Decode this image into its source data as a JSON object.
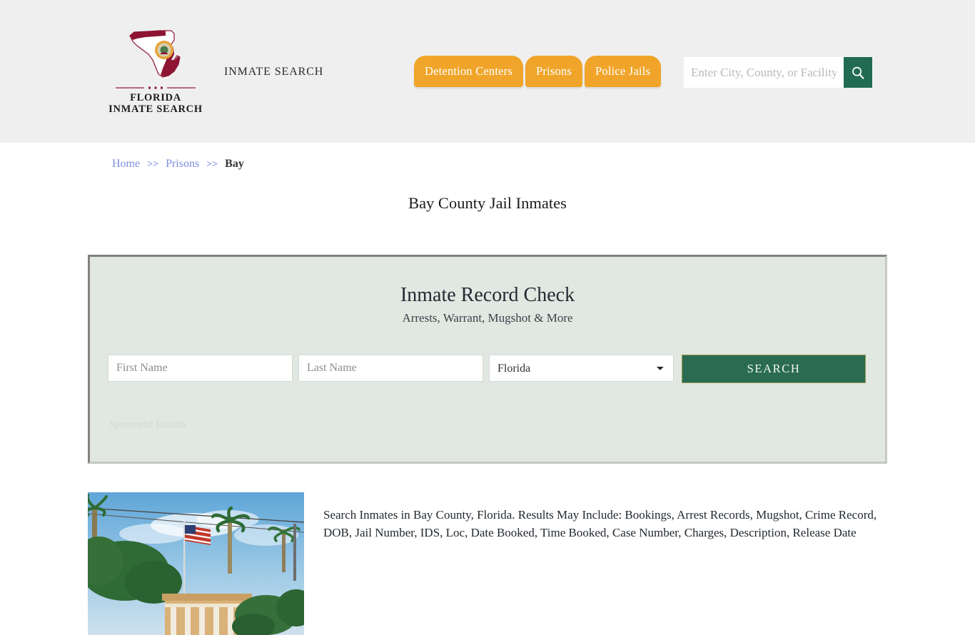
{
  "header": {
    "logo_icon": "florida-state-outline-icon",
    "brand_line1": "FLORIDA",
    "brand_line2": "INMATE SEARCH",
    "tagline": "INMATE SEARCH",
    "nav_tabs": [
      {
        "label": "Detention Centers",
        "name": "tab-detention-centers"
      },
      {
        "label": "Prisons",
        "name": "tab-prisons"
      },
      {
        "label": "Police Jails",
        "name": "tab-police-jails"
      }
    ],
    "search": {
      "placeholder": "Enter City, County, or Facility",
      "value": "",
      "button_icon": "search-icon"
    },
    "background_color": "#efefef",
    "tab_color": "#f0a52a",
    "accent_green": "#216b52"
  },
  "breadcrumb": {
    "items": [
      {
        "label": "Home",
        "current": false
      },
      {
        "label": "Prisons",
        "current": false
      },
      {
        "label": "Bay",
        "current": true
      }
    ],
    "separator": ">>"
  },
  "page": {
    "title": "Bay County Jail Inmates"
  },
  "record_panel": {
    "title": "Inmate Record Check",
    "subtitle": "Arrests, Warrant, Mugshot & More",
    "first_name_placeholder": "First Name",
    "first_name_value": "",
    "last_name_placeholder": "Last Name",
    "last_name_value": "",
    "state_selected": "Florida",
    "state_options": [
      "Florida"
    ],
    "search_button": "SEARCH",
    "sponsored_label": "Sponsored Results",
    "panel_background": "#e1e7e1",
    "button_color": "#2a6b52"
  },
  "content": {
    "photo_alt": "bay-county-jail-photo",
    "description": "Search Inmates in Bay County, Florida. Results May Include: Bookings, Arrest Records, Mugshot, Crime Record, DOB, Jail Number, IDS, Loc, Date Booked, Time Booked, Case Number, Charges, Description, Release Date"
  }
}
